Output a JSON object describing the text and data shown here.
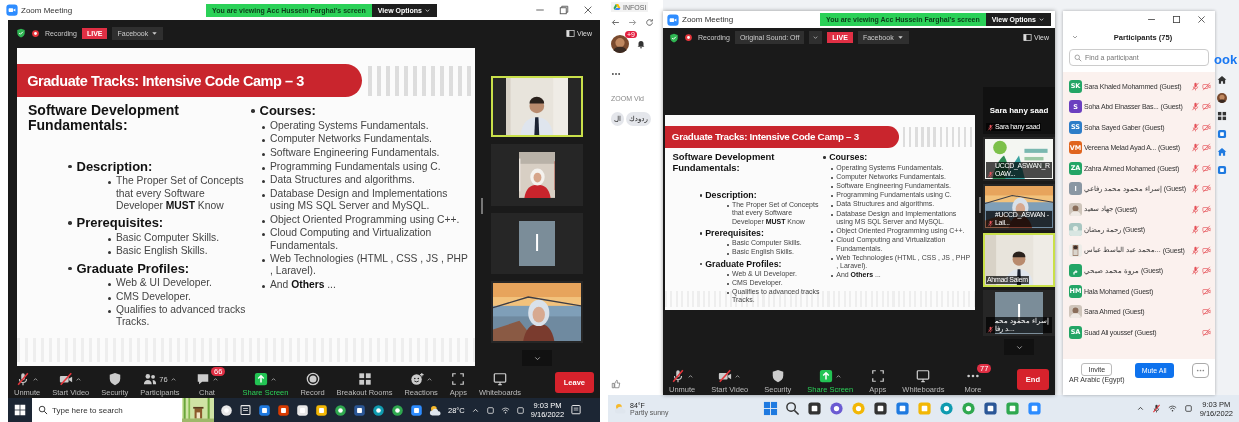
{
  "left_screen": {
    "window": {
      "app_title": "Zoom Meeting",
      "banner": "You are viewing Acc Hussein Farghal's screen",
      "view_options": "View Options"
    },
    "meeting_bar": {
      "recording": "Recording",
      "live": "LIVE",
      "stream": "Facebook",
      "view": "View"
    },
    "slide": {
      "title": "Graduate Tracks: Intensive Code Camp – 3",
      "left_heading": "Software Development Fundamentals:",
      "sections": [
        {
          "heading": "Description:",
          "items": [
            "The Proper Set of Concepts that every Software Developer **MUST** Know"
          ]
        },
        {
          "heading": "Prerequisites:",
          "items": [
            "Basic Computer Skills.",
            "Basic English Skills."
          ]
        },
        {
          "heading": "Graduate Profiles:",
          "items": [
            "Web & UI Developer.",
            "CMS Developer.",
            "Qualifies to advanced tracks Tracks."
          ]
        }
      ],
      "right_heading": "Courses:",
      "courses": [
        "Operating Systems Fundamentals.",
        "Computer Networks Fundamentals.",
        "Software Engineering Fundamentals.",
        "Programming Fundamentals using C.",
        "Data Structures and algorithms.",
        "Database Design and Implementations  using MS SQL Server and MySQL.",
        "Object Oriented Programming using C++.",
        "Cloud Computing and Virtualization Fundamentals.",
        "Web Technologies (HTML , CSS , JS , PHP , Laravel).",
        "And **Others** ..."
      ]
    },
    "video_tiles": [
      {
        "kind": "video",
        "active": true
      },
      {
        "kind": "video",
        "active": false
      },
      {
        "kind": "avatar",
        "initial": "ا",
        "active": false
      },
      {
        "kind": "video",
        "active": false
      }
    ],
    "toolbar": [
      {
        "label": "Unmute",
        "kind": "micoff",
        "caret": true,
        "highlighted": false
      },
      {
        "label": "Start Video",
        "kind": "vidoff",
        "caret": true,
        "highlighted": false
      },
      {
        "label": "Security",
        "kind": "shield",
        "caret": false,
        "highlighted": false
      },
      {
        "label": "Participants",
        "kind": "people",
        "count": "76",
        "caret": true,
        "highlighted": false
      },
      {
        "label": "Chat",
        "kind": "chat",
        "badge": "66",
        "caret": true,
        "highlighted": false
      },
      {
        "label": "Share Screen",
        "kind": "share",
        "caret": true,
        "highlighted": true
      },
      {
        "label": "Record",
        "kind": "record",
        "caret": false,
        "highlighted": false
      },
      {
        "label": "Breakout Rooms",
        "kind": "grid",
        "caret": false,
        "highlighted": false
      },
      {
        "label": "Reactions",
        "kind": "smile",
        "caret": true,
        "highlighted": false
      },
      {
        "label": "Apps",
        "kind": "apps",
        "caret": false,
        "highlighted": false
      },
      {
        "label": "Whiteboards",
        "kind": "board",
        "caret": false,
        "highlighted": false
      }
    ],
    "end_button": "Leave",
    "taskbar": {
      "search_field": {
        "placeholder": "Type here to search"
      },
      "temperature": "28°C",
      "time": "9:03 PM",
      "date": "9/16/2022"
    }
  },
  "right_screen": {
    "browser": {
      "tab": "INFOSI",
      "notification_badge": "+9",
      "page_text": "ZOOM Vid",
      "chips": [
        "ردودك",
        "ال"
      ],
      "facebook_logo": "ook"
    },
    "window": {
      "app_title": "Zoom Meeting",
      "banner": "You are viewing Acc Hussein Farghal's screen",
      "view_options": "View Options"
    },
    "meeting_bar": {
      "recording": "Recording",
      "original_sound": "Original Sound: Off",
      "live": "LIVE",
      "stream": "Facebook",
      "view": "View"
    },
    "slide": {
      "title": "Graduate Tracks: Intensive Code Camp – 3",
      "left_heading": "Software Development Fundamentals:",
      "sections": [
        {
          "heading": "Description:",
          "items": [
            "The Proper Set of Concepts that every Software Developer **MUST** Know"
          ]
        },
        {
          "heading": "Prerequisites:",
          "items": [
            "Basic Computer Skills.",
            "Basic English Skills."
          ]
        },
        {
          "heading": "Graduate Profiles:",
          "items": [
            "Web & UI Developer.",
            "CMS Developer.",
            "Qualifies to advanced tracks Tracks."
          ]
        }
      ],
      "right_heading": "Courses:",
      "courses": [
        "Operating Systems Fundamentals.",
        "Computer Networks Fundamentals.",
        "Software Engineering Fundamentals.",
        "Programming Fundamentals using C.",
        "Data Structures and algorithms.",
        "Database Design and Implementations  using MS SQL Server and MySQL.",
        "Object Oriented Programming using C++.",
        "Cloud Computing and Virtualization Fundamentals.",
        "Web Technologies (HTML , CSS , JS , PHP , Laravel).",
        "And **Others** ..."
      ]
    },
    "video_tiles": [
      {
        "kind": "name",
        "name": "Sara hany saad",
        "label": "Sara hany saad",
        "mic_muted": true,
        "active": false
      },
      {
        "kind": "video",
        "label": "UCCD_ASWAN_ROAW...",
        "mic_muted": true,
        "active": false
      },
      {
        "kind": "video",
        "label": "#UCCD_ASWAN - Lail...",
        "mic_muted": true,
        "active": false
      },
      {
        "kind": "video",
        "label": "Ahmad Salem",
        "mic_muted": false,
        "active": true
      },
      {
        "kind": "avatar",
        "initial": "ا",
        "label": "إسراء محمود محمد رفا...",
        "mic_muted": true,
        "active": false
      }
    ],
    "toolbar": [
      {
        "label": "Unmute",
        "kind": "micoff",
        "caret": true,
        "highlighted": false
      },
      {
        "label": "Start Video",
        "kind": "vidoff",
        "caret": true,
        "highlighted": false
      },
      {
        "label": "Security",
        "kind": "shield",
        "caret": false,
        "highlighted": false
      },
      {
        "label": "Share Screen",
        "kind": "share",
        "caret": true,
        "highlighted": true
      },
      {
        "label": "Apps",
        "kind": "apps",
        "caret": false,
        "highlighted": false
      },
      {
        "label": "Whiteboards",
        "kind": "board",
        "caret": false,
        "highlighted": false
      },
      {
        "label": "More",
        "kind": "more",
        "badge": "77",
        "caret": false,
        "highlighted": false
      }
    ],
    "end_button": "End",
    "participants": {
      "title": "Participants (75)",
      "search_field": {
        "placeholder": "Find a participant"
      },
      "rows": [
        {
          "kind": "initials",
          "initials": "SK",
          "color": "#23a566",
          "name": "Sara Khaled Mohammed",
          "guest": "(Guest)",
          "mic_muted": true,
          "video_off": true
        },
        {
          "kind": "initials",
          "initials": "S",
          "color": "#6b3fc0",
          "name": "Soha Abd Elnasser Bas...",
          "guest": "(Guest)",
          "mic_muted": true,
          "video_off": true
        },
        {
          "kind": "initials",
          "initials": "SS",
          "color": "#2d7dc8",
          "name": "Soha Sayed Gaber",
          "guest": "(Guest)",
          "mic_muted": true,
          "video_off": true
        },
        {
          "kind": "initials",
          "initials": "VM",
          "color": "#e0641e",
          "name": "Vereena Melad Ayad A...",
          "guest": "(Guest)",
          "mic_muted": true,
          "video_off": true
        },
        {
          "kind": "initials",
          "initials": "ZA",
          "color": "#23a566",
          "name": "Zahra Ahmed Mohamed",
          "guest": "(Guest)",
          "mic_muted": true,
          "video_off": true
        },
        {
          "kind": "initials",
          "initials": "ا",
          "color": "#8a97a3",
          "name": "إسراء محمود محمد رفاعي",
          "guest": "(Guest)",
          "mic_muted": true,
          "video_off": true
        },
        {
          "name": "جهاد سعيد",
          "guest": "(Guest)",
          "mic_muted": true,
          "video_off": true
        },
        {
          "name": "رحمة رمضان",
          "guest": "(Guest)",
          "mic_muted": true,
          "video_off": true
        },
        {
          "name": "محمد عبد الباسط عباس...",
          "guest": "(Guest)",
          "mic_muted": true,
          "video_off": true
        },
        {
          "kind": "initials",
          "initials": "م",
          "color": "#23a566",
          "name": "مروة محمد صبحي",
          "guest": "(Guest)",
          "mic_muted": true,
          "video_off": true
        },
        {
          "kind": "initials",
          "initials": "HM",
          "color": "#23a566",
          "name": "Hala Mohamed",
          "guest": "(Guest)",
          "mic_muted": false,
          "video_off": true
        },
        {
          "name": "Sara Ahmed",
          "guest": "(Guest)",
          "mic_muted": false,
          "video_off": true
        },
        {
          "kind": "initials",
          "initials": "SA",
          "color": "#23a566",
          "name": "Suad Ali youssef",
          "guest": "(Guest)",
          "mic_muted": false,
          "video_off": true
        }
      ],
      "invite": "Invite",
      "mute_all": "Mute All",
      "language": "AR Arabic (Egypt)"
    },
    "taskbar": {
      "temperature": "84°F",
      "weather": "Partly sunny",
      "time": "9:03 PM",
      "date": "9/16/2022"
    }
  }
}
